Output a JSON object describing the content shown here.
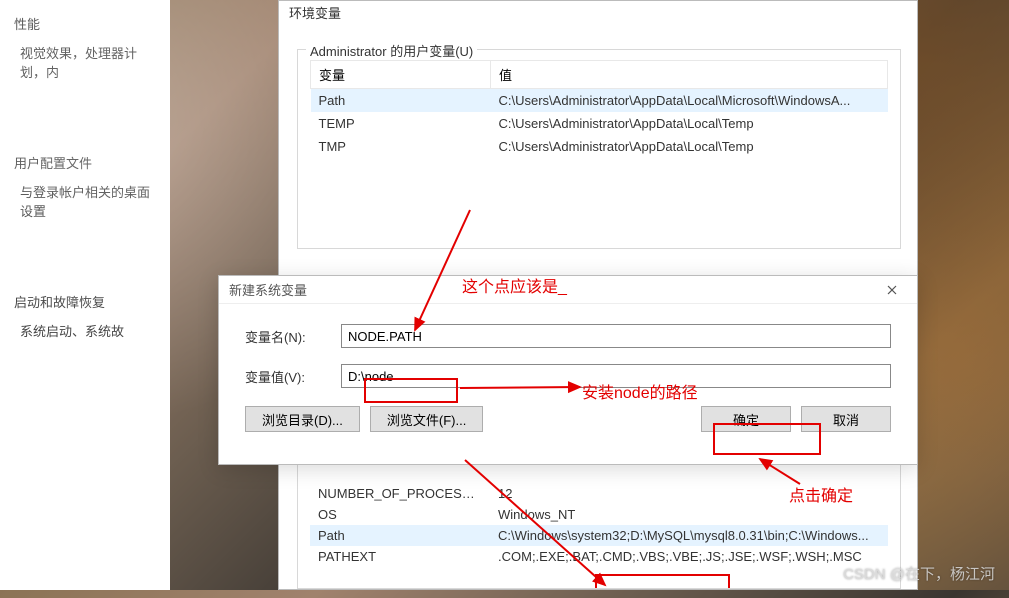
{
  "back_panel": {
    "sec1_title": "性能",
    "sec1_text": "视觉效果，处理器计划，内",
    "sec2_title": "用户配置文件",
    "sec2_text": "与登录帐户相关的桌面设置",
    "sec3_title": "启动和故障恢复",
    "sec3_text": "系统启动、系统故"
  },
  "env_dialog": {
    "title": "环境变量",
    "user_vars_legend": "Administrator 的用户变量(U)",
    "col_name": "变量",
    "col_value": "值",
    "user_vars": [
      {
        "name": "Path",
        "value": "C:\\Users\\Administrator\\AppData\\Local\\Microsoft\\WindowsA..."
      },
      {
        "name": "TEMP",
        "value": "C:\\Users\\Administrator\\AppData\\Local\\Temp"
      },
      {
        "name": "TMP",
        "value": "C:\\Users\\Administrator\\AppData\\Local\\Temp"
      }
    ],
    "sys_vars": [
      {
        "name": "NUMBER_OF_PROCESSORS",
        "value": "12"
      },
      {
        "name": "OS",
        "value": "Windows_NT"
      },
      {
        "name": "Path",
        "value": "C:\\Windows\\system32;D:\\MySQL\\mysql8.0.31\\bin;C:\\Windows..."
      },
      {
        "name": "PATHEXT",
        "value": ".COM;.EXE;.BAT;.CMD;.VBS;.VBE;.JS;.JSE;.WSF;.WSH;.MSC"
      }
    ]
  },
  "new_dialog": {
    "title": "新建系统变量",
    "name_label": "变量名(N):",
    "value_label": "变量值(V):",
    "name_value": "NODE.PATH",
    "value_value": "D:\\node",
    "browse_dir": "浏览目录(D)...",
    "browse_file": "浏览文件(F)...",
    "ok": "确定",
    "cancel": "取消"
  },
  "annotations": {
    "a1": "这个点应该是_",
    "a2": "安装node的路径",
    "a3": "点击确定"
  },
  "watermark": "CSDN @在下，杨江河"
}
